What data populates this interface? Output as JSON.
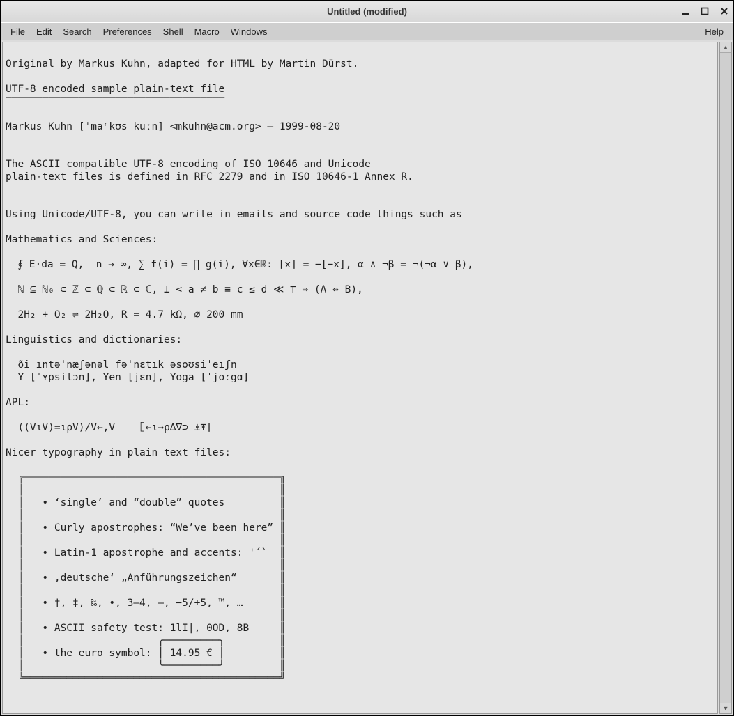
{
  "window": {
    "title": "Untitled (modified)"
  },
  "menubar": {
    "file": "File",
    "edit": "Edit",
    "search": "Search",
    "preferences": "Preferences",
    "shell": "Shell",
    "macro": "Macro",
    "windows": "Windows",
    "help": "Help"
  },
  "editor": {
    "content": "\nOriginal by Markus Kuhn, adapted for HTML by Martin Dürst.\n\nUTF-8 encoded sample plain-text file\n‾‾‾‾‾‾‾‾‾‾‾‾‾‾‾‾‾‾‾‾‾‾‾‾‾‾‾‾‾‾‾‾‾‾‾‾\n\nMarkus Kuhn [ˈmaʳkʊs kuːn] <mkuhn@acm.org> — 1999-08-20\n\n\nThe ASCII compatible UTF-8 encoding of ISO 10646 and Unicode\nplain-text files is defined in RFC 2279 and in ISO 10646-1 Annex R.\n\n\nUsing Unicode/UTF-8, you can write in emails and source code things such as\n\nMathematics and Sciences:\n\n  ∮ E⋅da = Q,  n → ∞, ∑ f(i) = ∏ g(i), ∀x∈ℝ: ⌈x⌉ = −⌊−x⌋, α ∧ ¬β = ¬(¬α ∨ β),\n\n  ℕ ⊆ ℕ₀ ⊂ ℤ ⊂ ℚ ⊂ ℝ ⊂ ℂ, ⊥ < a ≠ b ≡ c ≤ d ≪ ⊤ ⇒ (A ⇔ B),\n\n  2H₂ + O₂ ⇌ 2H₂O, R = 4.7 kΩ, ⌀ 200 mm\n\nLinguistics and dictionaries:\n\n  ði ıntəˈnæʃənəl fəˈnɛtık əsoʊsiˈeıʃn\n  Y [ˈʏpsilɔn], Yen [jɛn], Yoga [ˈjoːgɑ]\n\nAPL:\n\n  ((V⍳V)=⍳⍴V)/V←,V    ⌷←⍳→⍴∆∇⊃‾⍎⍕⌈\n\nNicer typography in plain text files:\n\n  ╔══════════════════════════════════════════╗\n  ║                                          ║\n  ║   • ‘single’ and “double” quotes         ║\n  ║                                          ║\n  ║   • Curly apostrophes: “We’ve been here” ║\n  ║                                          ║\n  ║   • Latin-1 apostrophe and accents: '´`  ║\n  ║                                          ║\n  ║   • ‚deutsche‘ „Anführungszeichen“       ║\n  ║                                          ║\n  ║   • †, ‡, ‰, •, 3–4, —, −5/+5, ™, …      ║\n  ║                                          ║\n  ║   • ASCII safety test: 1lI|, 0OD, 8B     ║\n  ║                      ╭─────────╮         ║\n  ║   • the euro symbol: │ 14.95 € │         ║\n  ║                      ╰─────────╯         ║\n  ╚══════════════════════════════════════════╝\n"
  }
}
